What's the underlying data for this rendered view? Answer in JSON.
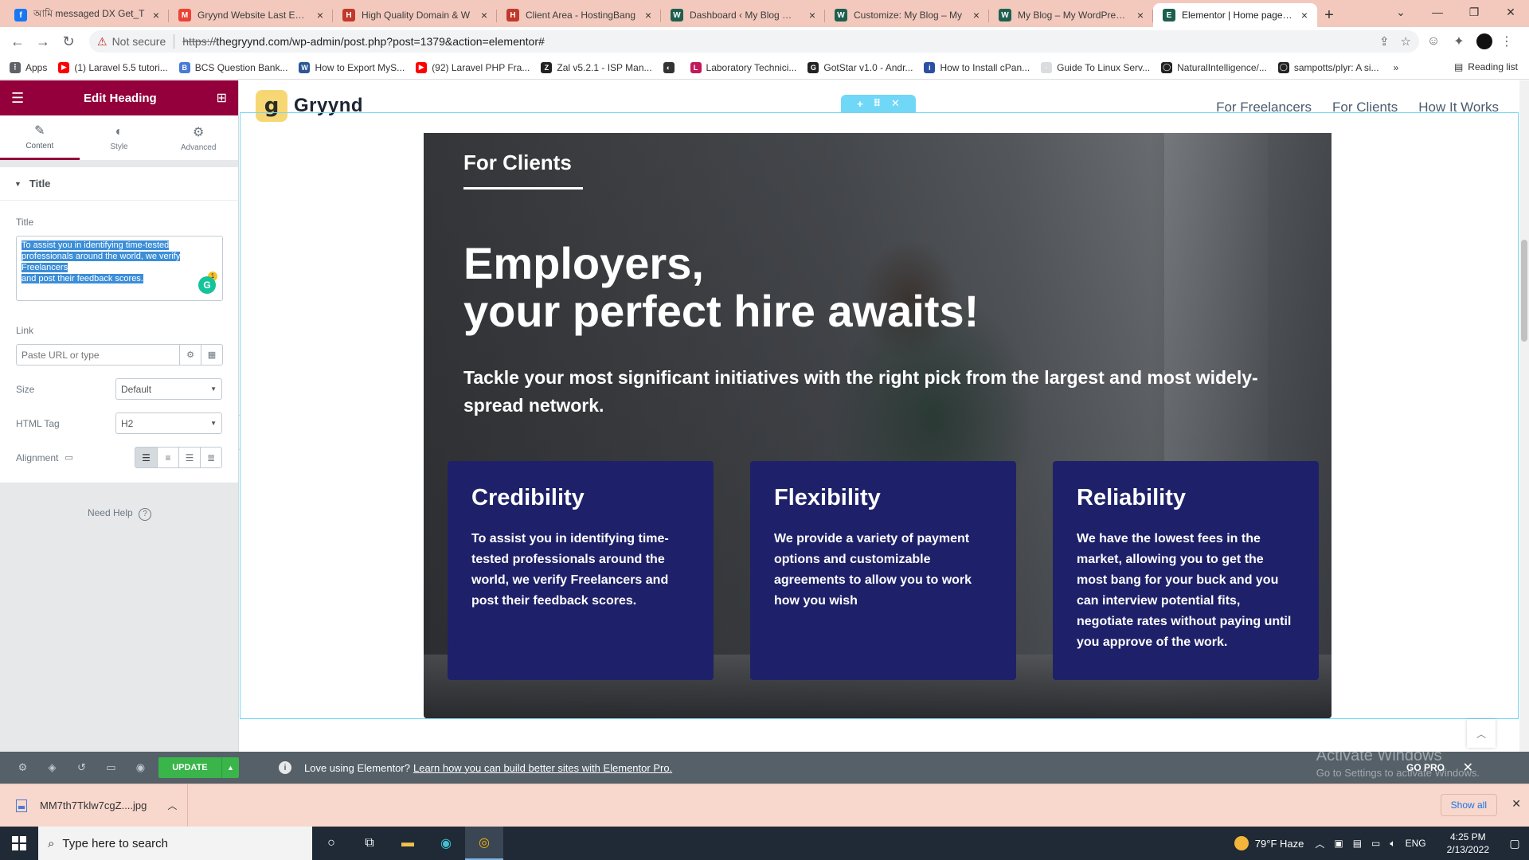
{
  "browser": {
    "tabs": [
      {
        "title": "আমি messaged DX Get_T",
        "icon_color": "#1877f2",
        "icon": "facebook-icon",
        "glyph": "f"
      },
      {
        "title": "Gryynd Website Last Edits",
        "icon_color": "#ea4335",
        "icon": "gmail-icon",
        "glyph": "M"
      },
      {
        "title": "High Quality Domain & W",
        "icon_color": "#c0392b",
        "icon": "hostingbangla-icon",
        "glyph": "H"
      },
      {
        "title": "Client Area - HostingBang",
        "icon_color": "#c0392b",
        "icon": "hostingbangla-icon",
        "glyph": "H"
      },
      {
        "title": "Dashboard ‹ My Blog — W",
        "icon_color": "#1d5f4e",
        "icon": "wordpress-icon",
        "glyph": "W"
      },
      {
        "title": "Customize: My Blog – My",
        "icon_color": "#1d5f4e",
        "icon": "wordpress-icon",
        "glyph": "W"
      },
      {
        "title": "My Blog – My WordPress B",
        "icon_color": "#1d5f4e",
        "icon": "wordpress-icon",
        "glyph": "W"
      },
      {
        "title": "Elementor | Home page v4",
        "icon_color": "#1d5f4e",
        "icon": "elementor-icon",
        "glyph": "E",
        "active": true
      }
    ],
    "not_secure": "Not secure",
    "url_scheme": "https://",
    "url_rest": "thegryynd.com/wp-admin/post.php?post=1379&action=elementor#",
    "bookmarks": [
      {
        "label": "Apps",
        "icon_color": "#5f6368",
        "glyph": "⋮"
      },
      {
        "label": "(1) Laravel 5.5 tutori...",
        "icon_color": "#ff0000",
        "glyph": "▶"
      },
      {
        "label": "BCS Question Bank...",
        "icon_color": "#4a7bd4",
        "glyph": "B"
      },
      {
        "label": "How to Export MyS...",
        "icon_color": "#2b5797",
        "glyph": "W"
      },
      {
        "label": "(92) Laravel PHP Fra...",
        "icon_color": "#ff0000",
        "glyph": "▶"
      },
      {
        "label": "Zal v5.2.1 - ISP Man...",
        "icon_color": "#222",
        "glyph": "Z"
      },
      {
        "label": "",
        "icon_color": "#333",
        "glyph": "◐"
      },
      {
        "label": "Laboratory Technici...",
        "icon_color": "#c2185b",
        "glyph": "L"
      },
      {
        "label": "GotStar v1.0 - Andr...",
        "icon_color": "#222",
        "glyph": "G"
      },
      {
        "label": "How to Install cPan...",
        "icon_color": "#2b4fa3",
        "glyph": "i"
      },
      {
        "label": "Guide To Linux Serv...",
        "icon_color": "#dadce0",
        "glyph": "·"
      },
      {
        "label": "NaturalIntelligence/...",
        "icon_color": "#222",
        "glyph": "◯"
      },
      {
        "label": "sampotts/plyr: A si...",
        "icon_color": "#222",
        "glyph": "◯"
      }
    ],
    "bookmarks_more": "»",
    "reading_list": "Reading list"
  },
  "editor": {
    "header_title": "Edit Heading",
    "tabs": [
      {
        "label": "Content",
        "icon": "pencil-icon",
        "glyph": "✎"
      },
      {
        "label": "Style",
        "icon": "contrast-icon",
        "glyph": "◐"
      },
      {
        "label": "Advanced",
        "icon": "gear-icon",
        "glyph": "⚙"
      }
    ],
    "section_title": "Title",
    "title_label": "Title",
    "title_value_lines": [
      "To assist you in identifying time-tested",
      "professionals around the world, we verify",
      "Freelancers",
      "and post their feedback scores."
    ],
    "grammarly_count": "1",
    "link_label": "Link",
    "link_placeholder": "Paste URL or type",
    "size_label": "Size",
    "size_value": "Default",
    "html_tag_label": "HTML Tag",
    "html_tag_value": "H2",
    "alignment_label": "Alignment",
    "need_help": "Need Help",
    "update_label": "UPDATE"
  },
  "site": {
    "logo_mark": "g",
    "logo_text": "Gryynd",
    "nav": [
      "For Freelancers",
      "For Clients",
      "How It Works"
    ],
    "hero_label": "For Clients",
    "hero_heading": "Employers,\nyour perfect hire awaits!",
    "hero_subheading": "Tackle your most significant initiatives with the right pick from the largest and most widely-spread network.",
    "cards": [
      {
        "title": "Credibility",
        "body": "To assist you in identifying time-tested professionals around the world, we verify Freelancers and post their feedback scores."
      },
      {
        "title": "Flexibility",
        "body": "We provide a variety of payment options and customizable agreements to allow you to work how you wish"
      },
      {
        "title": "Reliability",
        "body": "We have the lowest fees in the market, allowing you to get the most bang for your buck and you can interview potential fits, negotiate rates without paying until you approve of the work."
      }
    ]
  },
  "promo": {
    "text": "Love using Elementor?",
    "link": "Learn how you can build better sites with Elementor Pro.",
    "go_pro": "GO PRO",
    "activate_title": "Activate Windows",
    "activate_sub": "Go to Settings to activate Windows."
  },
  "downloads": {
    "file": "MM7th7Tklw7cgZ....jpg",
    "show_all": "Show all"
  },
  "taskbar": {
    "search_placeholder": "Type here to search",
    "weather": "79°F  Haze",
    "lang": "ENG",
    "time": "4:25 PM",
    "date": "2/13/2022"
  },
  "colors": {
    "elementor_header": "#93003c",
    "card_bg": "#1e2169",
    "update_green": "#39b54a",
    "tab_strip": "#f3c9bd"
  }
}
